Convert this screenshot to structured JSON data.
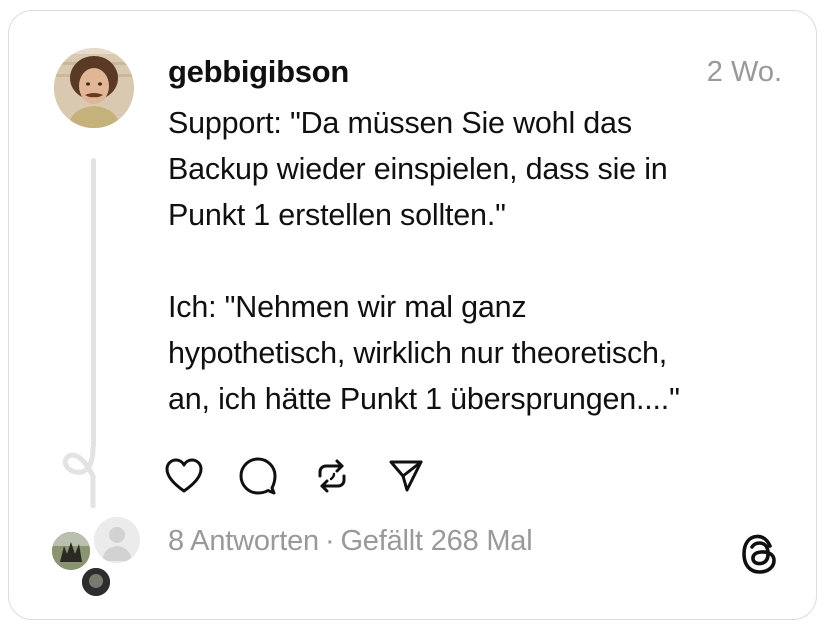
{
  "post": {
    "username": "gebbigibson",
    "timestamp": "2 Wo.",
    "text": "Support: \"Da müssen Sie wohl das\nBackup wieder einspielen, dass sie in\nPunkt 1 erstellen sollten.\"\n\nIch: \"Nehmen wir mal ganz\nhypothetisch, wirklich nur theoretisch,\nan, ich hätte Punkt 1 übersprungen....\""
  },
  "actions": [
    {
      "icon": "heart-icon"
    },
    {
      "icon": "comment-icon"
    },
    {
      "icon": "repost-icon"
    },
    {
      "icon": "share-icon"
    }
  ],
  "stats": {
    "replies": "8 Antworten",
    "separator": "·",
    "likes": "Gefällt 268 Mal"
  },
  "colors": {
    "text": "#101010",
    "muted": "#999999",
    "border": "#dcdcdc",
    "thread_line": "#e3e3e3"
  }
}
